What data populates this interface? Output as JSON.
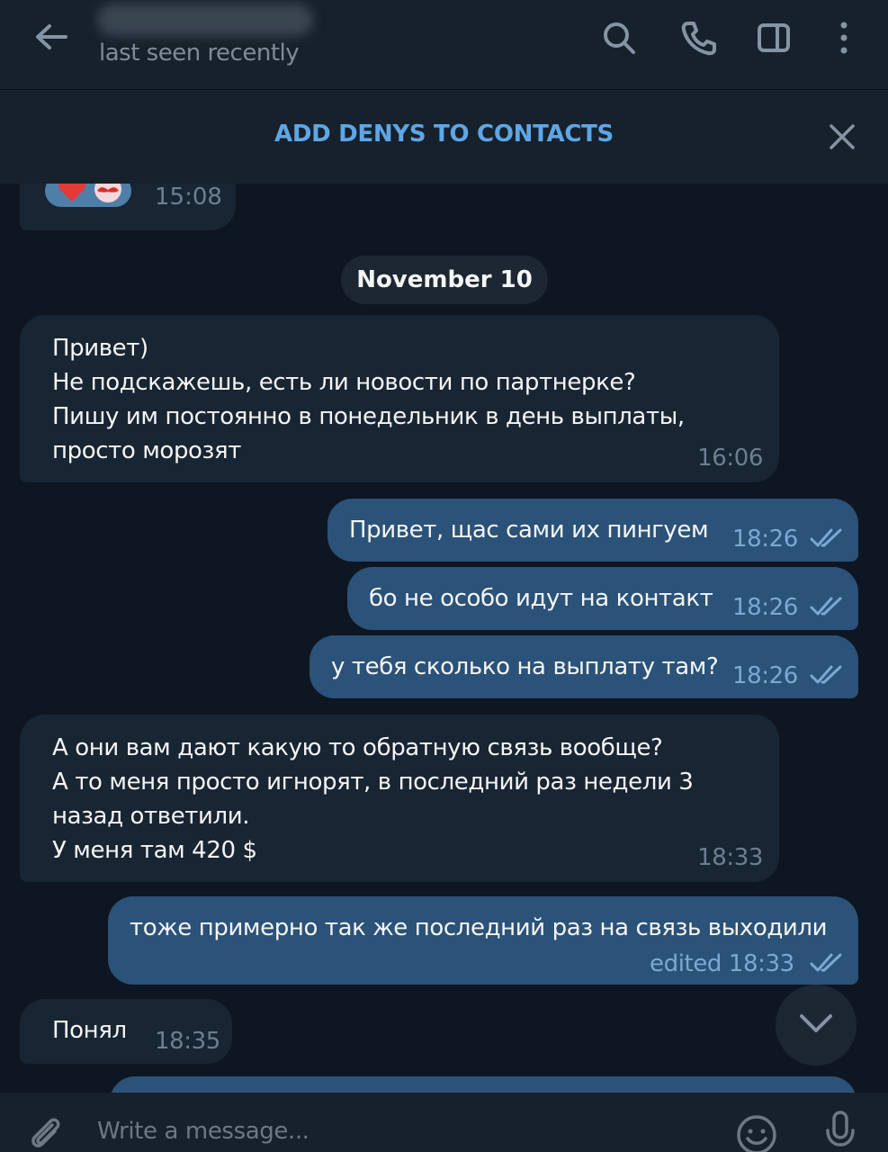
{
  "header": {
    "status": "last seen recently"
  },
  "contact_bar": {
    "label": "ADD DENYS TO CONTACTS"
  },
  "reaction_message": {
    "time": "15:08"
  },
  "date_separator": "November 10",
  "messages": [
    {
      "direction": "in",
      "text": "Привет)\nНе подскажешь, есть ли новости по партнерке?\nПишу им постоянно в понедельник в день выплаты,\nпросто морозят",
      "time": "16:06"
    },
    {
      "direction": "out",
      "text": "Привет, щас сами их пингуем",
      "time": "18:26",
      "read": true
    },
    {
      "direction": "out",
      "text": "бо не особо идут на контакт",
      "time": "18:26",
      "read": true
    },
    {
      "direction": "out",
      "text": "у тебя сколько на выплату там?",
      "time": "18:26",
      "read": true
    },
    {
      "direction": "in",
      "text": "А они вам дают какую то обратную связь вообще?\nА то меня просто игнорят, в последний раз недели 3\nназад ответили.\nУ меня там 420 $",
      "time": "18:33"
    },
    {
      "direction": "out",
      "text": "тоже примерно так же последний раз на связь выходили",
      "time": "edited 18:33",
      "read": true
    },
    {
      "direction": "in",
      "text": "Понял",
      "time": "18:35"
    }
  ],
  "composer": {
    "placeholder": "Write a message..."
  },
  "colors": {
    "background": "#0e1621",
    "header": "#17212b",
    "incoming_bubble": "#182533",
    "outgoing_bubble": "#2b5278",
    "accent": "#5ea6e6"
  },
  "icons": [
    "back-arrow-icon",
    "search-icon",
    "phone-icon",
    "sidebar-toggle-icon",
    "more-vertical-icon",
    "close-icon",
    "double-check-icon",
    "chevron-down-icon",
    "paperclip-icon",
    "emoji-icon",
    "microphone-icon"
  ]
}
